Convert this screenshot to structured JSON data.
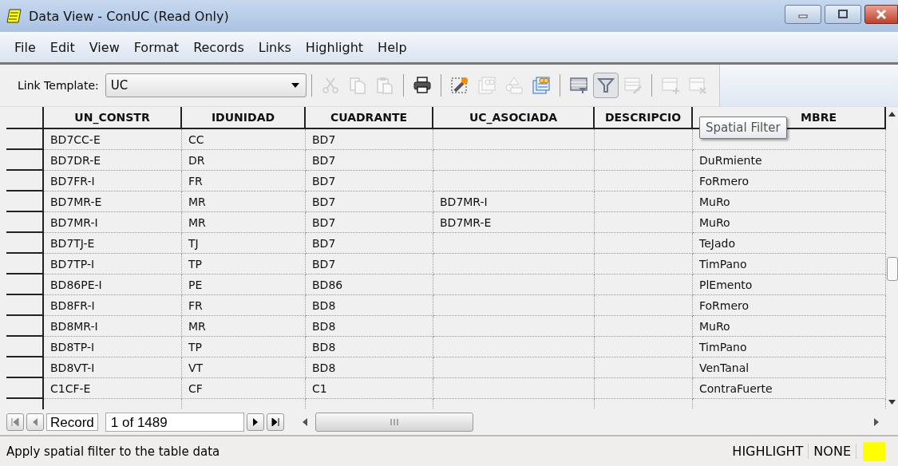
{
  "window": {
    "title": "Data View - ConUC (Read Only)"
  },
  "menu": [
    "File",
    "Edit",
    "View",
    "Format",
    "Records",
    "Links",
    "Highlight",
    "Help"
  ],
  "toolbar": {
    "link_template": {
      "label": "Link Template:",
      "value": "UC"
    },
    "buttons": [
      {
        "kind": "cut",
        "disabled": true,
        "pressed": false
      },
      {
        "kind": "copy",
        "disabled": true,
        "pressed": false
      },
      {
        "kind": "paste",
        "disabled": true,
        "pressed": false
      },
      {
        "kind": "separator"
      },
      {
        "kind": "print",
        "disabled": false,
        "pressed": false
      },
      {
        "kind": "separator"
      },
      {
        "kind": "new-link",
        "disabled": false,
        "pressed": false
      },
      {
        "kind": "link-record",
        "disabled": true,
        "pressed": false
      },
      {
        "kind": "link-shape",
        "disabled": true,
        "pressed": false
      },
      {
        "kind": "link-table",
        "disabled": false,
        "pressed": false
      },
      {
        "kind": "separator"
      },
      {
        "kind": "table-filter",
        "disabled": false,
        "pressed": false
      },
      {
        "kind": "funnel",
        "disabled": false,
        "pressed": true
      },
      {
        "kind": "table-edit",
        "disabled": true,
        "pressed": false
      },
      {
        "kind": "separator"
      },
      {
        "kind": "table-add",
        "disabled": true,
        "pressed": false
      },
      {
        "kind": "table-delete",
        "disabled": true,
        "pressed": false
      }
    ]
  },
  "tooltip": "Spatial Filter",
  "table": {
    "columns": [
      "UN_CONSTR",
      "IDUNIDAD",
      "CUADRANTE",
      "UC_ASOCIADA",
      "DESCRIPCIO",
      "MBRE"
    ],
    "rows": [
      [
        "BD7CC-E",
        "CC",
        "BD7",
        "",
        "",
        ""
      ],
      [
        "BD7DR-E",
        "DR",
        "BD7",
        "",
        "",
        "DuRmiente"
      ],
      [
        "BD7FR-I",
        "FR",
        "BD7",
        "",
        "",
        "FoRmero"
      ],
      [
        "BD7MR-E",
        "MR",
        "BD7",
        "BD7MR-I",
        "",
        "MuRo"
      ],
      [
        "BD7MR-I",
        "MR",
        "BD7",
        "BD7MR-E",
        "",
        "MuRo"
      ],
      [
        "BD7TJ-E",
        "TJ",
        "BD7",
        "",
        "",
        "TeJado"
      ],
      [
        "BD7TP-I",
        "TP",
        "BD7",
        "",
        "",
        "TimPano"
      ],
      [
        "BD86PE-I",
        "PE",
        "BD86",
        "",
        "",
        "PlEmento"
      ],
      [
        "BD8FR-I",
        "FR",
        "BD8",
        "",
        "",
        "FoRmero"
      ],
      [
        "BD8MR-I",
        "MR",
        "BD8",
        "",
        "",
        "MuRo"
      ],
      [
        "BD8TP-I",
        "TP",
        "BD8",
        "",
        "",
        "TimPano"
      ],
      [
        "BD8VT-I",
        "VT",
        "BD8",
        "",
        "",
        "VenTanal"
      ],
      [
        "C1CF-E",
        "CF",
        "C1",
        "",
        "",
        "ContraFuerte"
      ]
    ]
  },
  "navigation": {
    "label": "Record",
    "position": "1 of 1489"
  },
  "status_bar": {
    "message": "Apply spatial filter to the table data",
    "highlight_label": "HIGHLIGHT",
    "highlight_value": "NONE",
    "color": "#ffff00"
  }
}
